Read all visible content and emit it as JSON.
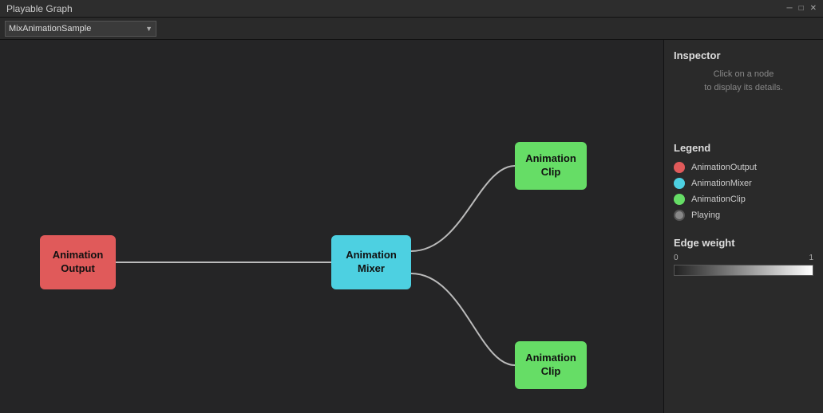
{
  "titleBar": {
    "title": "Playable Graph",
    "minBtn": "─",
    "maxBtn": "□",
    "closeBtn": "✕"
  },
  "toolbar": {
    "dropdown": {
      "value": "MixAnimationSample",
      "placeholder": "MixAnimationSample"
    }
  },
  "inspector": {
    "title": "Inspector",
    "hint_line1": "Click on a node",
    "hint_line2": "to display its details."
  },
  "legend": {
    "title": "Legend",
    "items": [
      {
        "label": "AnimationOutput",
        "color": "#e05a5a"
      },
      {
        "label": "AnimationMixer",
        "color": "#4dd0e1"
      },
      {
        "label": "AnimationClip",
        "color": "#66dd66"
      },
      {
        "label": "Playing",
        "color": "#888"
      }
    ]
  },
  "edgeWeight": {
    "title": "Edge weight",
    "min": "0",
    "max": "1"
  },
  "nodes": {
    "output": {
      "label": "Animation\nOutput"
    },
    "mixer": {
      "label": "Animation\nMixer"
    },
    "clipTop": {
      "label": "Animation\nClip"
    },
    "clipBottom": {
      "label": "Animation\nClip"
    }
  }
}
